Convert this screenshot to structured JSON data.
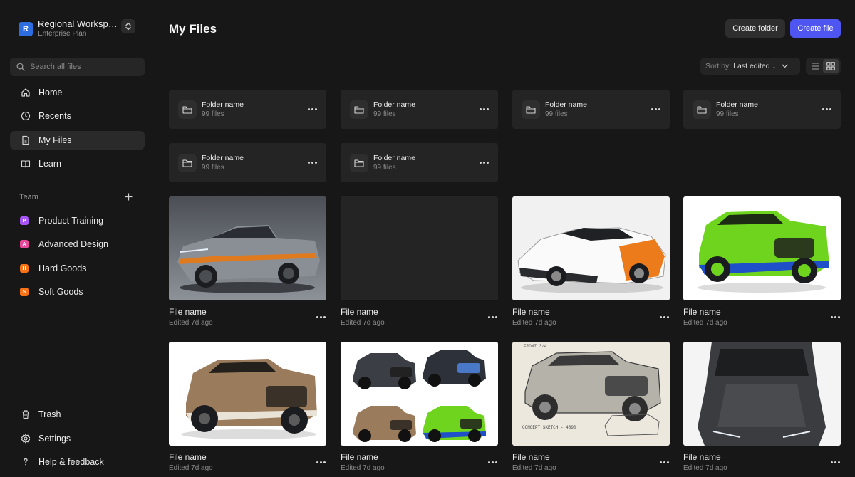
{
  "workspace": {
    "initial": "R",
    "name": "Regional Workspace",
    "plan": "Enterprise Plan",
    "accent": "#2e6de0"
  },
  "search": {
    "placeholder": "Search all files"
  },
  "nav": [
    {
      "label": "Home",
      "icon": "home-icon"
    },
    {
      "label": "Recents",
      "icon": "clock-icon"
    },
    {
      "label": "My Files",
      "icon": "file-icon",
      "active": true
    },
    {
      "label": "Learn",
      "icon": "book-icon"
    }
  ],
  "team": {
    "label": "Team",
    "items": [
      {
        "initial": "P",
        "label": "Product Training",
        "color": "#a855f7"
      },
      {
        "initial": "A",
        "label": "Advanced Design",
        "color": "#ec4899"
      },
      {
        "initial": "H",
        "label": "Hard Goods",
        "color": "#f97316"
      },
      {
        "initial": "S",
        "label": "Soft Goods",
        "color": "#f97316"
      }
    ]
  },
  "bottom_nav": [
    {
      "label": "Trash",
      "icon": "trash-icon"
    },
    {
      "label": "Settings",
      "icon": "gear-icon"
    },
    {
      "label": "Help & feedback",
      "icon": "question-icon"
    }
  ],
  "header": {
    "title": "My Files",
    "create_folder": "Create folder",
    "create_file": "Create file",
    "primary_color": "#4f55f0"
  },
  "sort": {
    "label": "Sort by:",
    "value": "Last edited ↓"
  },
  "view": {
    "mode": "grid"
  },
  "folders": [
    {
      "name": "Folder name",
      "count": "99 files"
    },
    {
      "name": "Folder name",
      "count": "99 files"
    },
    {
      "name": "Folder name",
      "count": "99 files"
    },
    {
      "name": "Folder name",
      "count": "99 files"
    },
    {
      "name": "Folder name",
      "count": "99 files"
    },
    {
      "name": "Folder name",
      "count": "99 files"
    }
  ],
  "files": [
    {
      "name": "File name",
      "meta": "Edited 7d ago",
      "thumb": "pickup-truck"
    },
    {
      "name": "File name",
      "meta": "Edited 7d ago",
      "thumb": "empty"
    },
    {
      "name": "File name",
      "meta": "Edited 7d ago",
      "thumb": "sports-car"
    },
    {
      "name": "File name",
      "meta": "Edited 7d ago",
      "thumb": "green-suv"
    },
    {
      "name": "File name",
      "meta": "Edited 7d ago",
      "thumb": "tan-suv"
    },
    {
      "name": "File name",
      "meta": "Edited 7d ago",
      "thumb": "suv-collage"
    },
    {
      "name": "File name",
      "meta": "Edited 7d ago",
      "thumb": "suv-sketch",
      "sketch_text_1": "FRONT 3/4",
      "sketch_text_2": "CONCEPT SKETCH - 4890"
    },
    {
      "name": "File name",
      "meta": "Edited 7d ago",
      "thumb": "dark-suv-top"
    }
  ]
}
